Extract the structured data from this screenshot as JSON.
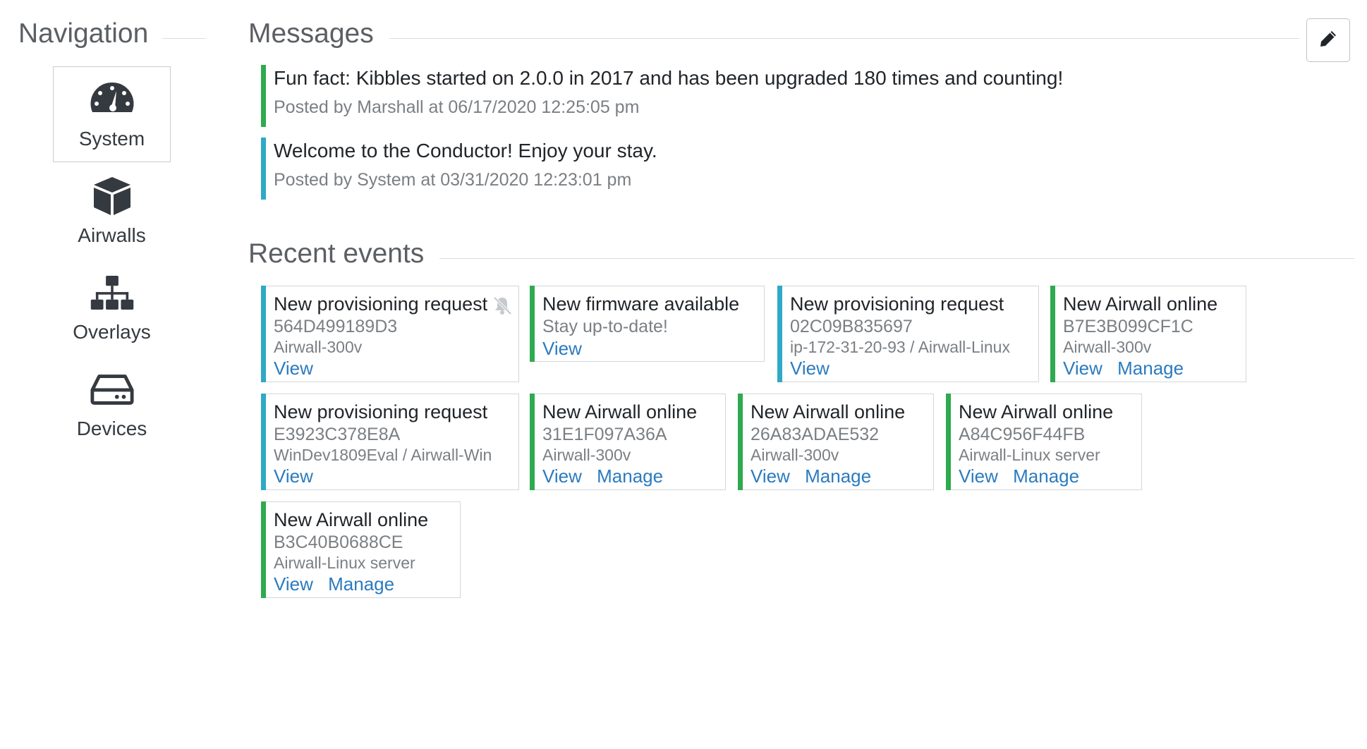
{
  "nav": {
    "title": "Navigation",
    "items": [
      {
        "label": "System",
        "icon": "tachometer-icon",
        "active": true
      },
      {
        "label": "Airwalls",
        "icon": "cube-icon",
        "active": false
      },
      {
        "label": "Overlays",
        "icon": "sitemap-icon",
        "active": false
      },
      {
        "label": "Devices",
        "icon": "hdd-icon",
        "active": false
      }
    ]
  },
  "messages": {
    "title": "Messages",
    "edit_icon": "pencil-icon",
    "items": [
      {
        "text": "Fun fact: Kibbles started on 2.0.0 in 2017 and has been upgraded 180 times and counting!",
        "meta": "Posted by Marshall at 06/17/2020 12:25:05 pm",
        "color": "#2eaa4f"
      },
      {
        "text": "Welcome to the Conductor! Enjoy your stay.",
        "meta": "Posted by System at 03/31/2020 12:23:01 pm",
        "color": "#2fa9c5"
      }
    ]
  },
  "events": {
    "title": "Recent events",
    "items": [
      {
        "title": "New provisioning request",
        "id": "564D499189D3",
        "detail": "Airwall-300v",
        "view": "View",
        "manage": "",
        "muted_icon": "bell-slash-icon",
        "color": "#2fa9c5"
      },
      {
        "title": "New firmware available",
        "id": "Stay up-to-date!",
        "detail": "",
        "view": "View",
        "manage": "",
        "color": "#2eaa4f"
      },
      {
        "title": "New provisioning request",
        "id": "02C09B835697",
        "detail": "ip-172-31-20-93 / Airwall-Linux",
        "view": "View",
        "manage": "",
        "color": "#2fa9c5"
      },
      {
        "title": "New Airwall online",
        "id": "B7E3B099CF1C",
        "detail": "Airwall-300v",
        "view": "View",
        "manage": "Manage",
        "color": "#2eaa4f"
      },
      {
        "title": "New provisioning request",
        "id": "E3923C378E8A",
        "detail": "WinDev1809Eval / Airwall-Win",
        "view": "View",
        "manage": "",
        "color": "#2fa9c5"
      },
      {
        "title": "New Airwall online",
        "id": "31E1F097A36A",
        "detail": "Airwall-300v",
        "view": "View",
        "manage": "Manage",
        "color": "#2eaa4f"
      },
      {
        "title": "New Airwall online",
        "id": "26A83ADAE532",
        "detail": "Airwall-300v",
        "view": "View",
        "manage": "Manage",
        "color": "#2eaa4f"
      },
      {
        "title": "New Airwall online",
        "id": "A84C956F44FB",
        "detail": "Airwall-Linux server",
        "view": "View",
        "manage": "Manage",
        "color": "#2eaa4f"
      },
      {
        "title": "New Airwall online",
        "id": "B3C40B0688CE",
        "detail": "Airwall-Linux server",
        "view": "View",
        "manage": "Manage",
        "color": "#2eaa4f"
      }
    ]
  }
}
